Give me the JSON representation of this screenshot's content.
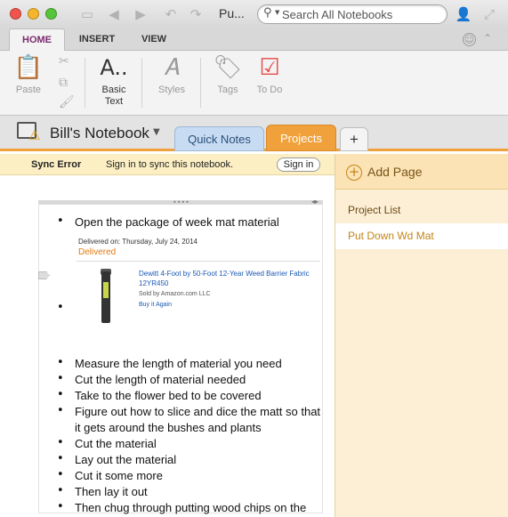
{
  "window": {
    "title": "Pu..."
  },
  "search": {
    "placeholder": "Search All Notebooks"
  },
  "ribbon_tabs": [
    "HOME",
    "INSERT",
    "VIEW"
  ],
  "ribbon": {
    "paste": "Paste",
    "basic_text": "Basic\nText",
    "basic_text_l1": "Basic",
    "basic_text_l2": "Text",
    "styles": "Styles",
    "tags": "Tags",
    "todo": "To Do"
  },
  "notebook": {
    "name": "Bill's Notebook"
  },
  "sections": [
    "Quick Notes",
    "Projects",
    "+"
  ],
  "sync": {
    "error_label": "Sync Error",
    "message": "Sign in to sync this notebook.",
    "button": "Sign in"
  },
  "pages": {
    "add_label": "Add Page",
    "items": [
      "Project List",
      "Put Down Wd Mat"
    ]
  },
  "note": {
    "items": [
      "Open the package of week mat material",
      "Measure the length of material you need",
      "Cut the length of material needed",
      "Take to the flower bed to be covered",
      "Figure out how to slice and dice the matt so that it gets around the bushes and plants",
      "Cut the material",
      "Lay out the material",
      "Cut it some more",
      "Then lay it out",
      "Then chug through putting wood chips on the material"
    ],
    "embedded": {
      "delivered_on": "Delivered on: Thursday, July 24, 2014",
      "status": "Delivered",
      "product": "Dewitt 4-Foot by 50-Foot 12-Year Weed Barrier Fabric 12YR450",
      "sold_by": "Sold by Amazon.com LLC",
      "buy_again": "Buy it Again"
    }
  },
  "colors": {
    "accent": "#f1a13b",
    "ribbon_tab_active": "#7a2c6e",
    "quick_notes_tab": "#c7dcf3"
  }
}
